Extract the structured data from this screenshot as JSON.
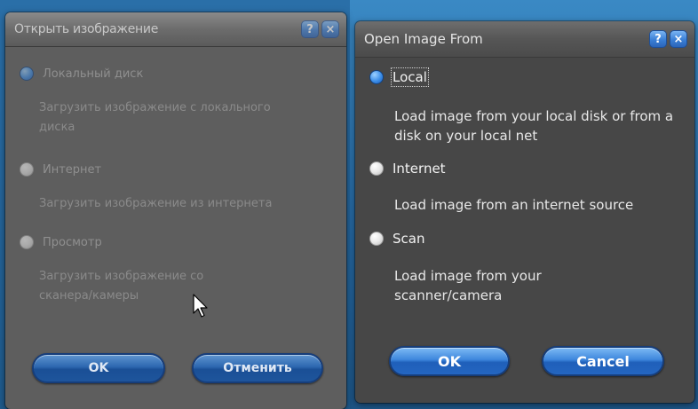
{
  "left_dialog": {
    "title": "Открыть изображение",
    "help_label": "?",
    "close_label": "×",
    "options": [
      {
        "label": "Локальный диск",
        "description": "Загрузить изображение с локального диска",
        "checked": true
      },
      {
        "label": "Интернет",
        "description": "Загрузить изображение из интернета",
        "checked": false
      },
      {
        "label": "Просмотр",
        "description": "Загрузить изображение со сканера/камеры",
        "checked": false
      }
    ],
    "ok_label": "OK",
    "cancel_label": "Отменить"
  },
  "right_dialog": {
    "title": "Open Image From",
    "help_label": "?",
    "close_label": "×",
    "options": [
      {
        "label": "Local",
        "description": "Load image from your local disk or from a disk on your local net",
        "checked": true
      },
      {
        "label": "Internet",
        "description": "Load image from an internet source",
        "checked": false
      },
      {
        "label": "Scan",
        "description": "Load image from your scanner/camera",
        "checked": false
      }
    ],
    "ok_label": "OK",
    "cancel_label": "Cancel"
  },
  "colors": {
    "accent_blue": "#3d86dc",
    "dialog_bg": "#474747",
    "desktop_bg": "#2a6fa8"
  },
  "icons": {
    "help": "help-icon",
    "close": "close-icon",
    "cursor": "mouse-cursor-icon"
  }
}
